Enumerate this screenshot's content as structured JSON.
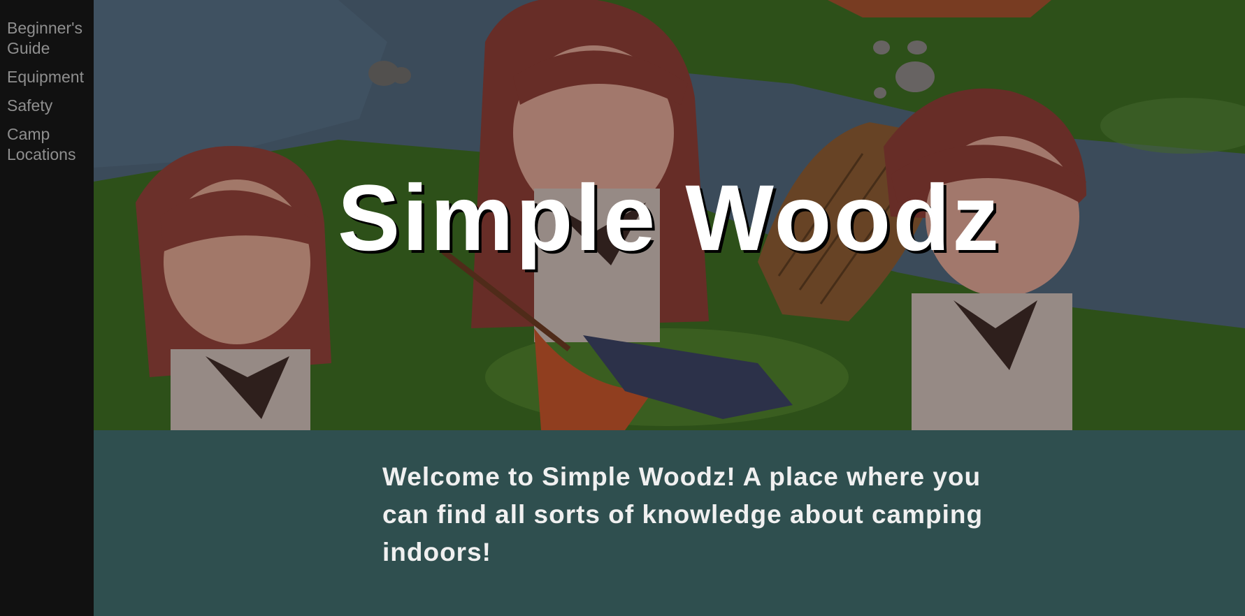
{
  "sidebar": {
    "items": [
      {
        "label": "Beginner's Guide"
      },
      {
        "label": "Equipment"
      },
      {
        "label": "Safety"
      },
      {
        "label": "Camp Locations"
      }
    ]
  },
  "hero": {
    "title": "Simple Woodz"
  },
  "welcome": {
    "text": "Welcome to Simple Woodz! A place where you can find all sorts of knowledge about camping indoors!"
  },
  "colors": {
    "sidebar_bg": "#111111",
    "nav_text": "#8f8f8f",
    "welcome_bg": "#2f4f4f",
    "title_text": "#ffffff"
  }
}
